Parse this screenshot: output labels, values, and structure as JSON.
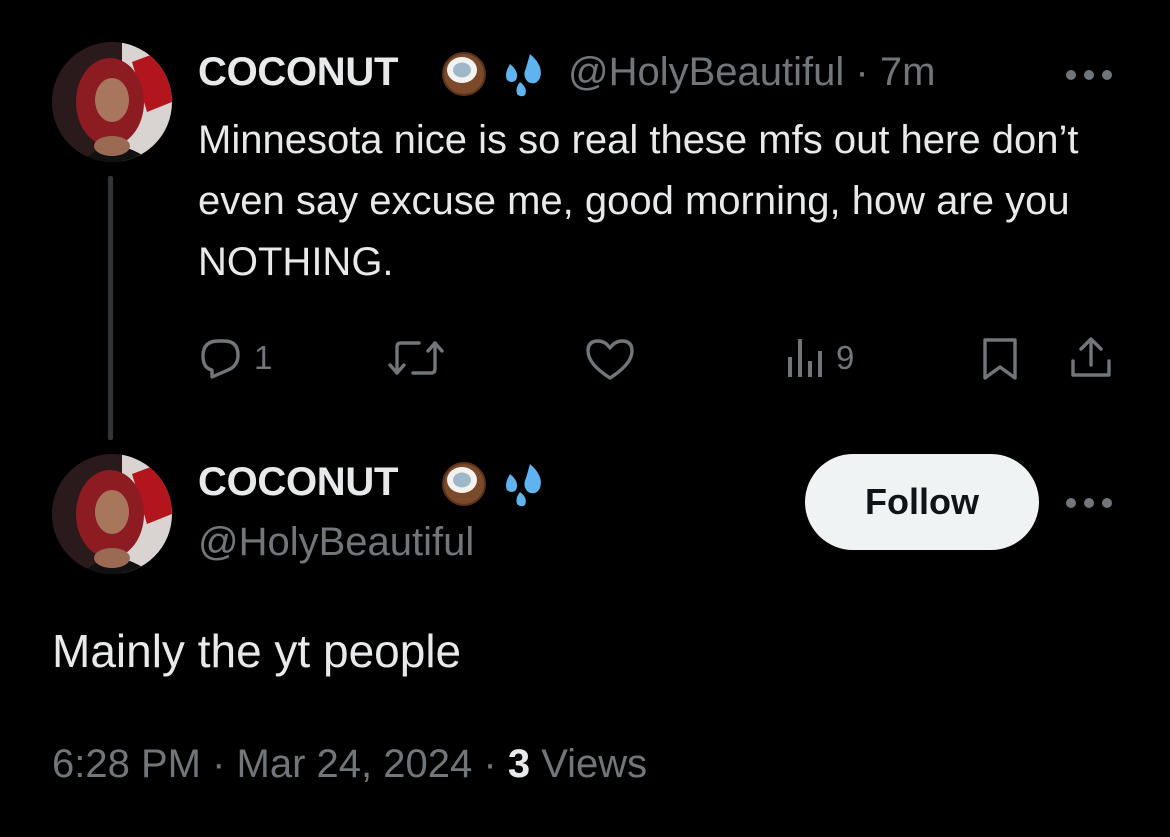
{
  "parent_tweet": {
    "display_name": "COCONUT",
    "emojis": [
      "coconut-emoji",
      "sweat-droplets-emoji"
    ],
    "handle": "@HolyBeautiful",
    "separator": "·",
    "time_ago": "7m",
    "text": "Minnesota nice is so real these mfs out here don’t even say excuse me, good morning, how are you NOTHING.",
    "actions": {
      "reply_count": "1",
      "retweet_count": "",
      "like_count": "",
      "views_count": "9"
    }
  },
  "reply_tweet": {
    "display_name": "COCONUT",
    "emojis": [
      "coconut-emoji",
      "sweat-droplets-emoji"
    ],
    "handle": "@HolyBeautiful",
    "follow_label": "Follow",
    "text": "Mainly the yt people",
    "time": "6:28 PM",
    "separator": "·",
    "date": "Mar 24, 2024",
    "views_count": "3",
    "views_label": "Views"
  },
  "colors": {
    "background": "#000000",
    "text_primary": "#e7e9ea",
    "text_muted": "#71767b",
    "follow_bg": "#eff3f4",
    "follow_text": "#0f1419"
  }
}
